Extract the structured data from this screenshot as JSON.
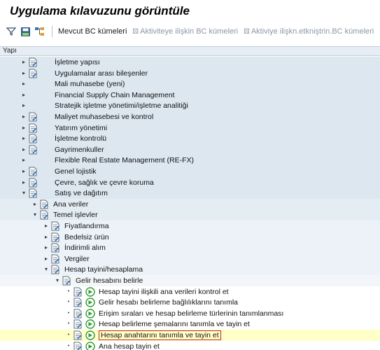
{
  "window": {
    "title": "Uygulama kılavuzunu görüntüle"
  },
  "toolbar": {
    "icons": [
      "filter-icon",
      "save-variant-icon",
      "tree-structure-icon"
    ],
    "existing_bc_sets": "Mevcut BC kümeleri",
    "activity_bc_sets": "Aktiviteye ilişkin BC kümeleri",
    "activity_link_bc_sets": "Aktiviye ilişkn.etkniştrin.BC kümeleri"
  },
  "tree_header": {
    "label": "Yapı"
  },
  "tree": {
    "rows": [
      {
        "level": 0,
        "expander": "collapsed",
        "icon": "doc",
        "exec": false,
        "label": "İşletme yapısı"
      },
      {
        "level": 0,
        "expander": "collapsed",
        "icon": "doc",
        "exec": false,
        "label": "Uygulamalar arası bileşenler"
      },
      {
        "level": 0,
        "expander": "collapsed",
        "icon": "none",
        "exec": false,
        "label": "Mali muhasebe (yeni)"
      },
      {
        "level": 0,
        "expander": "collapsed",
        "icon": "none",
        "exec": false,
        "label": "Financial Supply Chain Management"
      },
      {
        "level": 0,
        "expander": "collapsed",
        "icon": "none",
        "exec": false,
        "label": "Stratejik işletme yönetimi/işletme analitiği"
      },
      {
        "level": 0,
        "expander": "collapsed",
        "icon": "doc",
        "exec": false,
        "label": "Maliyet muhasebesi ve kontrol"
      },
      {
        "level": 0,
        "expander": "collapsed",
        "icon": "doc",
        "exec": false,
        "label": "Yatırım yönetimi"
      },
      {
        "level": 0,
        "expander": "collapsed",
        "icon": "doc",
        "exec": false,
        "label": "İşletme kontrolü"
      },
      {
        "level": 0,
        "expander": "collapsed",
        "icon": "doc",
        "exec": false,
        "label": "Gayrimenkuller"
      },
      {
        "level": 0,
        "expander": "collapsed",
        "icon": "none",
        "exec": false,
        "label": "Flexible Real Estate Management (RE-FX)"
      },
      {
        "level": 0,
        "expander": "collapsed",
        "icon": "doc",
        "exec": false,
        "label": "Genel lojistik"
      },
      {
        "level": 0,
        "expander": "collapsed",
        "icon": "doc",
        "exec": false,
        "label": "Çevre, sağlık ve çevre koruma"
      },
      {
        "level": 0,
        "expander": "expanded",
        "icon": "doc",
        "exec": false,
        "label": "Satış ve dağıtım"
      },
      {
        "level": 1,
        "expander": "collapsed",
        "icon": "doc",
        "exec": false,
        "label": "Ana veriler"
      },
      {
        "level": 1,
        "expander": "expanded",
        "icon": "doc",
        "exec": false,
        "label": "Temel işlevler"
      },
      {
        "level": 2,
        "expander": "collapsed",
        "icon": "doc",
        "exec": false,
        "label": "Fiyatlandırma"
      },
      {
        "level": 2,
        "expander": "collapsed",
        "icon": "doc",
        "exec": false,
        "label": "Bedelsiz ürün"
      },
      {
        "level": 2,
        "expander": "collapsed",
        "icon": "doc",
        "exec": false,
        "label": "İndirimli alım"
      },
      {
        "level": 2,
        "expander": "collapsed",
        "icon": "doc",
        "exec": false,
        "label": "Vergiler"
      },
      {
        "level": 2,
        "expander": "expanded",
        "icon": "doc",
        "exec": false,
        "label": "Hesap tayini/hesaplama"
      },
      {
        "level": 3,
        "expander": "expanded",
        "icon": "doc",
        "exec": false,
        "label": "Gelir hesabını belirle"
      },
      {
        "level": 4,
        "expander": "leaf",
        "icon": "doc",
        "exec": true,
        "label": "Hesap tayini ilişkili ana verileri kontrol et"
      },
      {
        "level": 4,
        "expander": "leaf",
        "icon": "doc",
        "exec": true,
        "label": "Gelir hesabı belirleme bağlılıklarını tanımla"
      },
      {
        "level": 4,
        "expander": "leaf",
        "icon": "doc",
        "exec": true,
        "label": "Erişim sıraları ve hesap belirleme türlerinin tanımlanması"
      },
      {
        "level": 4,
        "expander": "leaf",
        "icon": "doc",
        "exec": true,
        "label": "Hesap belirleme şemalarını tanımla ve tayin et"
      },
      {
        "level": 4,
        "expander": "leaf",
        "icon": "doc",
        "exec": true,
        "label": "Hesap anahtarını tanımla ve tayin et",
        "selected": true
      },
      {
        "level": 4,
        "expander": "leaf",
        "icon": "doc",
        "exec": true,
        "label": "Ana hesap tayin et"
      }
    ]
  },
  "colors": {
    "selected_row": "#ffffc8",
    "selection_border": "#d02020",
    "exec_icon": "#2e9a2e"
  }
}
